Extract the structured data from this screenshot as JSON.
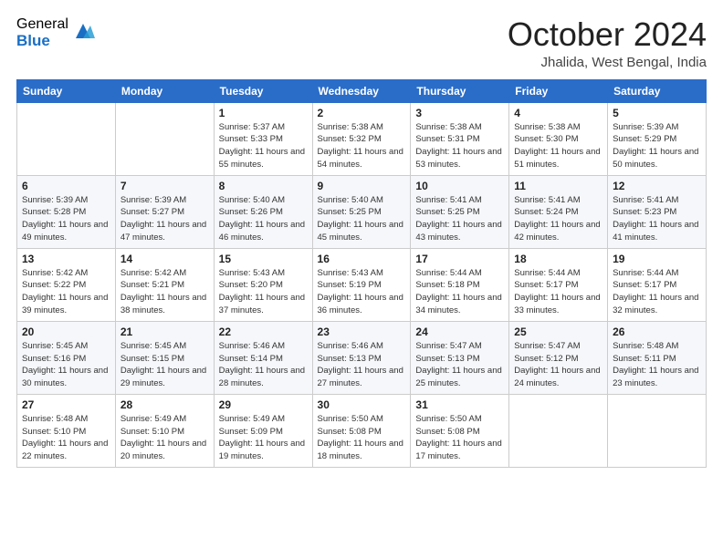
{
  "logo": {
    "general": "General",
    "blue": "Blue"
  },
  "title": "October 2024",
  "location": "Jhalida, West Bengal, India",
  "headers": [
    "Sunday",
    "Monday",
    "Tuesday",
    "Wednesday",
    "Thursday",
    "Friday",
    "Saturday"
  ],
  "weeks": [
    [
      {
        "day": "",
        "info": ""
      },
      {
        "day": "",
        "info": ""
      },
      {
        "day": "1",
        "info": "Sunrise: 5:37 AM\nSunset: 5:33 PM\nDaylight: 11 hours and 55 minutes."
      },
      {
        "day": "2",
        "info": "Sunrise: 5:38 AM\nSunset: 5:32 PM\nDaylight: 11 hours and 54 minutes."
      },
      {
        "day": "3",
        "info": "Sunrise: 5:38 AM\nSunset: 5:31 PM\nDaylight: 11 hours and 53 minutes."
      },
      {
        "day": "4",
        "info": "Sunrise: 5:38 AM\nSunset: 5:30 PM\nDaylight: 11 hours and 51 minutes."
      },
      {
        "day": "5",
        "info": "Sunrise: 5:39 AM\nSunset: 5:29 PM\nDaylight: 11 hours and 50 minutes."
      }
    ],
    [
      {
        "day": "6",
        "info": "Sunrise: 5:39 AM\nSunset: 5:28 PM\nDaylight: 11 hours and 49 minutes."
      },
      {
        "day": "7",
        "info": "Sunrise: 5:39 AM\nSunset: 5:27 PM\nDaylight: 11 hours and 47 minutes."
      },
      {
        "day": "8",
        "info": "Sunrise: 5:40 AM\nSunset: 5:26 PM\nDaylight: 11 hours and 46 minutes."
      },
      {
        "day": "9",
        "info": "Sunrise: 5:40 AM\nSunset: 5:25 PM\nDaylight: 11 hours and 45 minutes."
      },
      {
        "day": "10",
        "info": "Sunrise: 5:41 AM\nSunset: 5:25 PM\nDaylight: 11 hours and 43 minutes."
      },
      {
        "day": "11",
        "info": "Sunrise: 5:41 AM\nSunset: 5:24 PM\nDaylight: 11 hours and 42 minutes."
      },
      {
        "day": "12",
        "info": "Sunrise: 5:41 AM\nSunset: 5:23 PM\nDaylight: 11 hours and 41 minutes."
      }
    ],
    [
      {
        "day": "13",
        "info": "Sunrise: 5:42 AM\nSunset: 5:22 PM\nDaylight: 11 hours and 39 minutes."
      },
      {
        "day": "14",
        "info": "Sunrise: 5:42 AM\nSunset: 5:21 PM\nDaylight: 11 hours and 38 minutes."
      },
      {
        "day": "15",
        "info": "Sunrise: 5:43 AM\nSunset: 5:20 PM\nDaylight: 11 hours and 37 minutes."
      },
      {
        "day": "16",
        "info": "Sunrise: 5:43 AM\nSunset: 5:19 PM\nDaylight: 11 hours and 36 minutes."
      },
      {
        "day": "17",
        "info": "Sunrise: 5:44 AM\nSunset: 5:18 PM\nDaylight: 11 hours and 34 minutes."
      },
      {
        "day": "18",
        "info": "Sunrise: 5:44 AM\nSunset: 5:17 PM\nDaylight: 11 hours and 33 minutes."
      },
      {
        "day": "19",
        "info": "Sunrise: 5:44 AM\nSunset: 5:17 PM\nDaylight: 11 hours and 32 minutes."
      }
    ],
    [
      {
        "day": "20",
        "info": "Sunrise: 5:45 AM\nSunset: 5:16 PM\nDaylight: 11 hours and 30 minutes."
      },
      {
        "day": "21",
        "info": "Sunrise: 5:45 AM\nSunset: 5:15 PM\nDaylight: 11 hours and 29 minutes."
      },
      {
        "day": "22",
        "info": "Sunrise: 5:46 AM\nSunset: 5:14 PM\nDaylight: 11 hours and 28 minutes."
      },
      {
        "day": "23",
        "info": "Sunrise: 5:46 AM\nSunset: 5:13 PM\nDaylight: 11 hours and 27 minutes."
      },
      {
        "day": "24",
        "info": "Sunrise: 5:47 AM\nSunset: 5:13 PM\nDaylight: 11 hours and 25 minutes."
      },
      {
        "day": "25",
        "info": "Sunrise: 5:47 AM\nSunset: 5:12 PM\nDaylight: 11 hours and 24 minutes."
      },
      {
        "day": "26",
        "info": "Sunrise: 5:48 AM\nSunset: 5:11 PM\nDaylight: 11 hours and 23 minutes."
      }
    ],
    [
      {
        "day": "27",
        "info": "Sunrise: 5:48 AM\nSunset: 5:10 PM\nDaylight: 11 hours and 22 minutes."
      },
      {
        "day": "28",
        "info": "Sunrise: 5:49 AM\nSunset: 5:10 PM\nDaylight: 11 hours and 20 minutes."
      },
      {
        "day": "29",
        "info": "Sunrise: 5:49 AM\nSunset: 5:09 PM\nDaylight: 11 hours and 19 minutes."
      },
      {
        "day": "30",
        "info": "Sunrise: 5:50 AM\nSunset: 5:08 PM\nDaylight: 11 hours and 18 minutes."
      },
      {
        "day": "31",
        "info": "Sunrise: 5:50 AM\nSunset: 5:08 PM\nDaylight: 11 hours and 17 minutes."
      },
      {
        "day": "",
        "info": ""
      },
      {
        "day": "",
        "info": ""
      }
    ]
  ]
}
